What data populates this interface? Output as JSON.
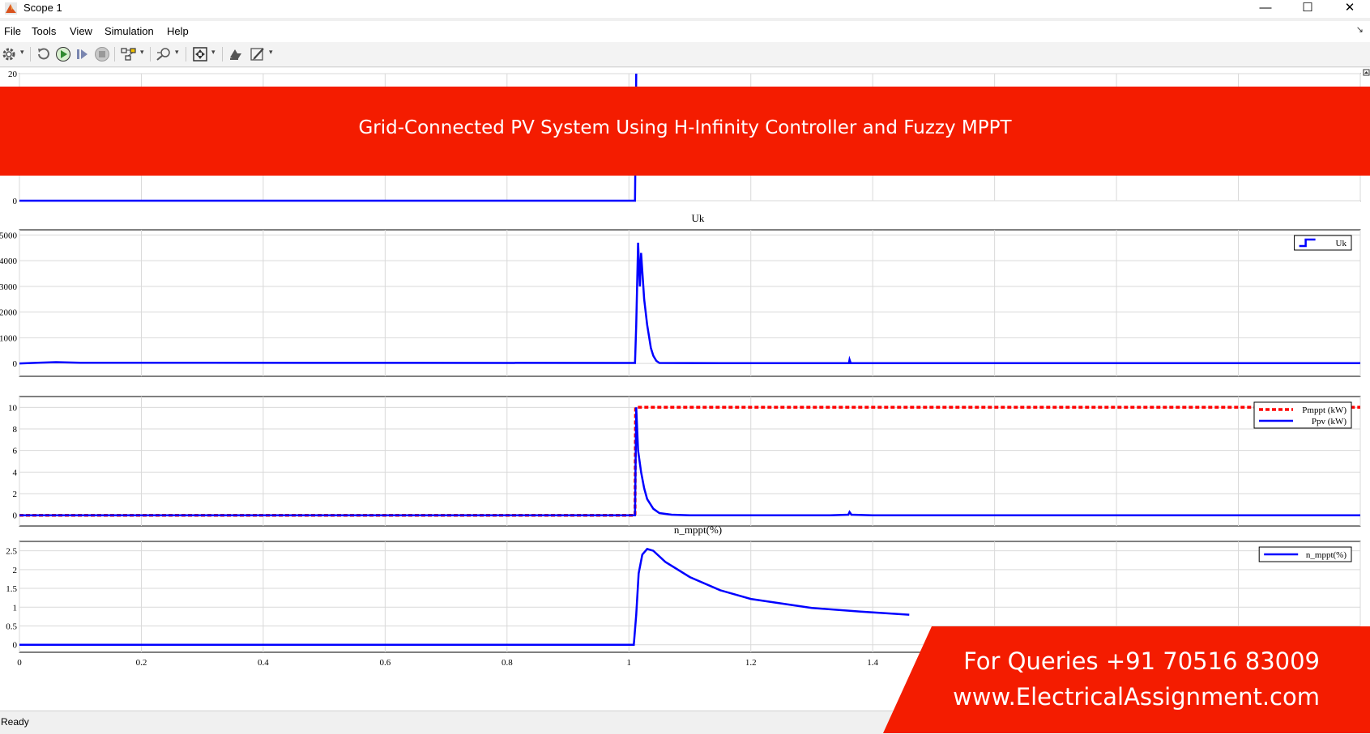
{
  "window": {
    "title": "Scope 1",
    "minimize_glyph": "—",
    "maximize_glyph": "☐",
    "close_glyph": "✕"
  },
  "menu": {
    "items": [
      "File",
      "Tools",
      "View",
      "Simulation",
      "Help"
    ],
    "corner_glyph": "↘"
  },
  "toolbar": {
    "icons": [
      "settings-icon",
      "restore-icon",
      "run-icon",
      "step-forward-icon",
      "stop-icon",
      "highlight-block-icon",
      "zoom-icon",
      "autoscale-icon",
      "restore-layout-icon",
      "edit-style-icon"
    ],
    "dropdown_glyph": "▾"
  },
  "status": {
    "text": "Ready"
  },
  "banners": {
    "top": "Grid-Connected PV System Using H-Infinity Controller and Fuzzy MPPT",
    "query": "For Queries +91 70516 83009",
    "website": "www.ElectricalAssignment.com"
  },
  "colors": {
    "banner": "#f41c00",
    "signal_blue": "#0000ff",
    "reference_red": "#ff0000",
    "grid": "#d9d9d9"
  },
  "chart_data": [
    {
      "type": "line",
      "title": "",
      "visible_yticks": [
        0,
        20
      ],
      "ylim": [
        0,
        20
      ],
      "x": [
        0,
        1.01,
        1.012
      ],
      "series": [
        {
          "values": [
            0,
            0,
            20
          ],
          "color": "#0000ff"
        }
      ],
      "legend": {
        "position": "top-right",
        "entries": []
      }
    },
    {
      "type": "line",
      "title": "Uk",
      "yticks": [
        0,
        1000,
        2000,
        3000,
        4000,
        5000
      ],
      "ytick_labels": [
        "0",
        "1000",
        "2000",
        "3000",
        "4000",
        "5000"
      ],
      "ylim": [
        -500,
        5200
      ],
      "xlim": [
        0,
        2.2
      ],
      "xticks": [
        0,
        0.2,
        0.4,
        0.6,
        0.8,
        1.0,
        1.2,
        1.4,
        1.6,
        1.8,
        2.0,
        2.2
      ],
      "series": [
        {
          "name": "Uk",
          "color": "#0000ff",
          "x": [
            0,
            0.03,
            0.06,
            0.1,
            1.0,
            1.01,
            1.012,
            1.015,
            1.018,
            1.02,
            1.025,
            1.03,
            1.036,
            1.04,
            1.045,
            1.05,
            1.2,
            1.361,
            1.362,
            1.364,
            1.5,
            2.2
          ],
          "values": [
            0,
            30,
            50,
            30,
            20,
            20,
            1500,
            4700,
            3000,
            4300,
            2500,
            1500,
            600,
            300,
            100,
            20,
            10,
            10,
            150,
            10,
            10,
            10
          ]
        }
      ],
      "legend": {
        "position": "top-right",
        "entries": [
          "Uk"
        ]
      }
    },
    {
      "type": "line",
      "title": "",
      "yticks": [
        0,
        2,
        4,
        6,
        8,
        10
      ],
      "ytick_labels": [
        "0",
        "2",
        "4",
        "6",
        "8",
        "10"
      ],
      "ylim": [
        -1,
        11
      ],
      "xlim": [
        0,
        2.2
      ],
      "series": [
        {
          "name": "Pmppt (kW)",
          "color": "#ff0000",
          "dashed": true,
          "x": [
            0,
            1.01,
            1.011,
            2.2
          ],
          "values": [
            0,
            0,
            10,
            10
          ]
        },
        {
          "name": "Ppv (kW)",
          "color": "#0000ff",
          "x": [
            0,
            1.0,
            1.01,
            1.012,
            1.015,
            1.02,
            1.025,
            1.03,
            1.04,
            1.05,
            1.07,
            1.1,
            1.2,
            1.33,
            1.36,
            1.362,
            1.365,
            1.4,
            2.2
          ],
          "values": [
            0,
            0,
            0,
            10,
            6,
            4,
            2.5,
            1.5,
            0.6,
            0.2,
            0.05,
            0,
            0,
            0,
            0.05,
            0.3,
            0.05,
            0,
            0
          ]
        }
      ],
      "legend": {
        "position": "top-right",
        "entries": [
          "Pmppt (kW)",
          "Ppv (kW)"
        ]
      }
    },
    {
      "type": "line",
      "title": "n_mppt(%)",
      "yticks": [
        0,
        0.5,
        1,
        1.5,
        2,
        2.5
      ],
      "ytick_labels": [
        "0",
        "0.5",
        "1",
        "1.5",
        "2",
        "2.5"
      ],
      "ylim": [
        -0.2,
        2.75
      ],
      "xlim": [
        0,
        2.2
      ],
      "xticks": [
        0,
        0.2,
        0.4,
        0.6,
        0.8,
        1.0,
        1.2,
        1.4
      ],
      "xtick_labels": [
        "0",
        "0.2",
        "0.4",
        "0.6",
        "0.8",
        "1",
        "1.2",
        "1.4"
      ],
      "series": [
        {
          "name": "n_mppt(%)",
          "color": "#0000ff",
          "x": [
            0,
            1.008,
            1.012,
            1.016,
            1.022,
            1.03,
            1.04,
            1.06,
            1.1,
            1.15,
            1.2,
            1.3,
            1.38,
            1.46
          ],
          "values": [
            0,
            0,
            0.8,
            1.9,
            2.4,
            2.55,
            2.5,
            2.2,
            1.8,
            1.45,
            1.22,
            0.98,
            0.88,
            0.8
          ]
        }
      ],
      "legend": {
        "position": "top-right",
        "entries": [
          "n_mppt(%)"
        ]
      }
    }
  ]
}
